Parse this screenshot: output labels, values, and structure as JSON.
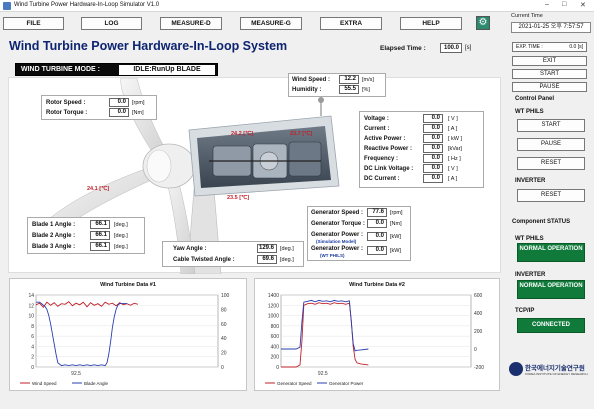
{
  "window": {
    "title": "Wind Turbine Power Hardware-In-Loop Simulator V1.0"
  },
  "menu": [
    "FILE",
    "LOG",
    "MEASURE-D",
    "MEASURE-G",
    "EXTRA",
    "HELP"
  ],
  "current_time": {
    "label": "Current Time",
    "value": "2021-01-25 오후 7:57:57"
  },
  "page_title": "Wind Turbine Power Hardware-In-Loop System",
  "elapsed": {
    "label": "Elapsed Time :",
    "value": "100.0",
    "unit": "[s]"
  },
  "mode": {
    "label": "WIND TURBINE MODE :",
    "value": "IDLE:RunUp BLADE"
  },
  "rotor": [
    {
      "label": "Rotor Speed :",
      "value": "0.0",
      "unit": "[rpm]"
    },
    {
      "label": "Rotor Torque :",
      "value": "0.0",
      "unit": "[Nm]"
    }
  ],
  "wind": [
    {
      "label": "Wind Speed :",
      "value": "12.2",
      "unit": "[m/s]"
    },
    {
      "label": "Humidity :",
      "value": "55.5",
      "unit": "[%]"
    }
  ],
  "electrical": [
    {
      "label": "Voltage :",
      "value": "0.0",
      "unit": "[ V ]"
    },
    {
      "label": "Current :",
      "value": "0.0",
      "unit": "[ A ]"
    },
    {
      "label": "Active Power :",
      "value": "0.0",
      "unit": "[ kW ]"
    },
    {
      "label": "Reactive Power :",
      "value": "0.0",
      "unit": "[kVar]"
    },
    {
      "label": "Frequency :",
      "value": "0.0",
      "unit": "[ Hz ]"
    },
    {
      "label": "DC Link Voltage :",
      "value": "0.0",
      "unit": "[ V ]"
    },
    {
      "label": "DC Current :",
      "value": "0.0",
      "unit": "[ A ]"
    }
  ],
  "temperatures": [
    "24.2 [℃]",
    "23.7 [℃]",
    "24.1 [℃]",
    "23.5 [℃]"
  ],
  "blades": [
    {
      "label": "Blade 1 Angle :",
      "value": "66.1",
      "unit": "[deg.]"
    },
    {
      "label": "Blade 2 Angle :",
      "value": "66.1",
      "unit": "[deg.]"
    },
    {
      "label": "Blade 3 Angle :",
      "value": "66.1",
      "unit": "[deg.]"
    }
  ],
  "yaw": [
    {
      "label": "Yaw Angle :",
      "value": "129.6",
      "unit": "[deg.]"
    },
    {
      "label": "Cable Twisted Angle :",
      "value": "69.6",
      "unit": "[deg.]"
    }
  ],
  "generator": [
    {
      "label": "Generator Speed :",
      "value": "77.6",
      "unit": "[rpm]",
      "sub": ""
    },
    {
      "label": "Generator Torque :",
      "value": "0.0",
      "unit": "[Nm]",
      "sub": ""
    },
    {
      "label": "Generator Power :",
      "value": "0.0",
      "unit": "[kW]",
      "sub": "(Simulation Model)"
    },
    {
      "label": "Generator Power :",
      "value": "0.0",
      "unit": "[kW]",
      "sub": "(WT PHILS)"
    }
  ],
  "right": {
    "exp_time": {
      "label": "EXP. TIME :",
      "value": "0.0 [s]"
    },
    "exit": "EXIT",
    "start": "START",
    "pause": "PAUSE",
    "control_panel": "Control Panel",
    "wt_phils": "WT PHILS",
    "wt_start": "START",
    "wt_pause": "PAUSE",
    "wt_reset": "RESET",
    "inverter": "INVERTER",
    "inv_reset": "RESET",
    "component_status": "Component STATUS",
    "wt_phils_s": "WT PHILS",
    "wt_phils_status": "NORMAL OPERATION",
    "inverter_s": "INVERTER",
    "inverter_status": "NORMAL OPERATION",
    "tcpip": "TCP/IP",
    "tcpip_status": "CONNECTED",
    "logo_text": "한국에너지기술연구원",
    "logo_sub": "KOREA INSTITUTE OF ENERGY RESEARCH"
  },
  "colors": {
    "title": "#0d2470",
    "status_green": "#0f7a3a",
    "series_red": "#c0202a",
    "series_blue": "#2a3fb0"
  },
  "chart_data": [
    {
      "type": "line",
      "title": "Wind Turbine Data #1",
      "x_tick": "92.5",
      "y_left_ticks": [
        "0",
        "2",
        "4",
        "6",
        "8",
        "10",
        "12",
        "14"
      ],
      "y_right_ticks": [
        "0",
        "20",
        "40",
        "60",
        "80",
        "100"
      ],
      "y_left_range": [
        0,
        14
      ],
      "y_right_range": [
        0,
        100
      ],
      "x_range": [
        0,
        100
      ],
      "series": [
        {
          "name": "Wind Speed",
          "axis": "left",
          "color": "#c0202a",
          "x": [
            0,
            2,
            4,
            6,
            8,
            10,
            12,
            14,
            16,
            18,
            20,
            22,
            24,
            26,
            28,
            30,
            32,
            34,
            36,
            38,
            40,
            42,
            44,
            46,
            48,
            50,
            52,
            54,
            56
          ],
          "y": [
            12.1,
            12.4,
            11.6,
            12.6,
            12.0,
            12.5,
            11.8,
            12.3,
            12.2,
            12.7,
            11.9,
            12.4,
            12.1,
            12.6,
            11.7,
            12.5,
            12.0,
            12.3,
            11.8,
            12.6,
            12.2,
            12.4,
            11.9,
            12.5,
            12.1,
            12.3,
            12.0,
            12.4,
            12.2
          ]
        },
        {
          "name": "Blade Angle",
          "axis": "right",
          "color": "#2a3fb0",
          "x": [
            0,
            1,
            2,
            3,
            4,
            5,
            6,
            7,
            8,
            9,
            10,
            11,
            12,
            14,
            16,
            18,
            20,
            22,
            24,
            26,
            28,
            30,
            32,
            34,
            36,
            38,
            39,
            40,
            41,
            42,
            43,
            44,
            45,
            46,
            48,
            50
          ],
          "y": [
            90,
            90,
            90,
            88,
            86,
            84,
            80,
            72,
            60,
            46,
            32,
            18,
            6,
            2,
            3,
            2,
            3,
            2,
            3,
            2,
            3,
            2,
            3,
            2,
            3,
            2,
            6,
            18,
            35,
            55,
            70,
            80,
            86,
            88,
            88,
            88
          ]
        }
      ],
      "legend": "bottom-left"
    },
    {
      "type": "line",
      "title": "Wind Turbine Data #2",
      "x_tick": "92.5",
      "y_left_ticks": [
        "0",
        "200",
        "400",
        "600",
        "800",
        "1000",
        "1200",
        "1400"
      ],
      "y_right_ticks": [
        "-200",
        "0",
        "200",
        "400",
        "600"
      ],
      "y_left_range": [
        0,
        1400
      ],
      "y_right_range": [
        -200,
        600
      ],
      "x_range": [
        0,
        100
      ],
      "series": [
        {
          "name": "Generator Speed",
          "axis": "left",
          "color": "#c0202a",
          "x": [
            0,
            4,
            8,
            10,
            11,
            12,
            14,
            16,
            18,
            20,
            22,
            24,
            26,
            28,
            30,
            32,
            34,
            36,
            37,
            38,
            39,
            40,
            42,
            44,
            46
          ],
          "y": [
            0,
            0,
            0,
            40,
            500,
            1200,
            1230,
            1240,
            1220,
            1250,
            1230,
            1240,
            1220,
            1250,
            1230,
            1240,
            1220,
            1240,
            900,
            400,
            150,
            80,
            60,
            50,
            40
          ]
        },
        {
          "name": "Generator Power",
          "axis": "right",
          "color": "#2a3fb0",
          "x": [
            0,
            4,
            8,
            10,
            11,
            12,
            14,
            16,
            18,
            20,
            22,
            24,
            26,
            28,
            30,
            32,
            34,
            36,
            37,
            38,
            39,
            40,
            42,
            44,
            46
          ],
          "y": [
            0,
            0,
            0,
            20,
            300,
            520,
            530,
            540,
            525,
            540,
            530,
            535,
            525,
            540,
            530,
            535,
            525,
            535,
            300,
            60,
            -20,
            -15,
            -10,
            -5,
            0
          ]
        }
      ],
      "legend": "bottom-left"
    }
  ]
}
